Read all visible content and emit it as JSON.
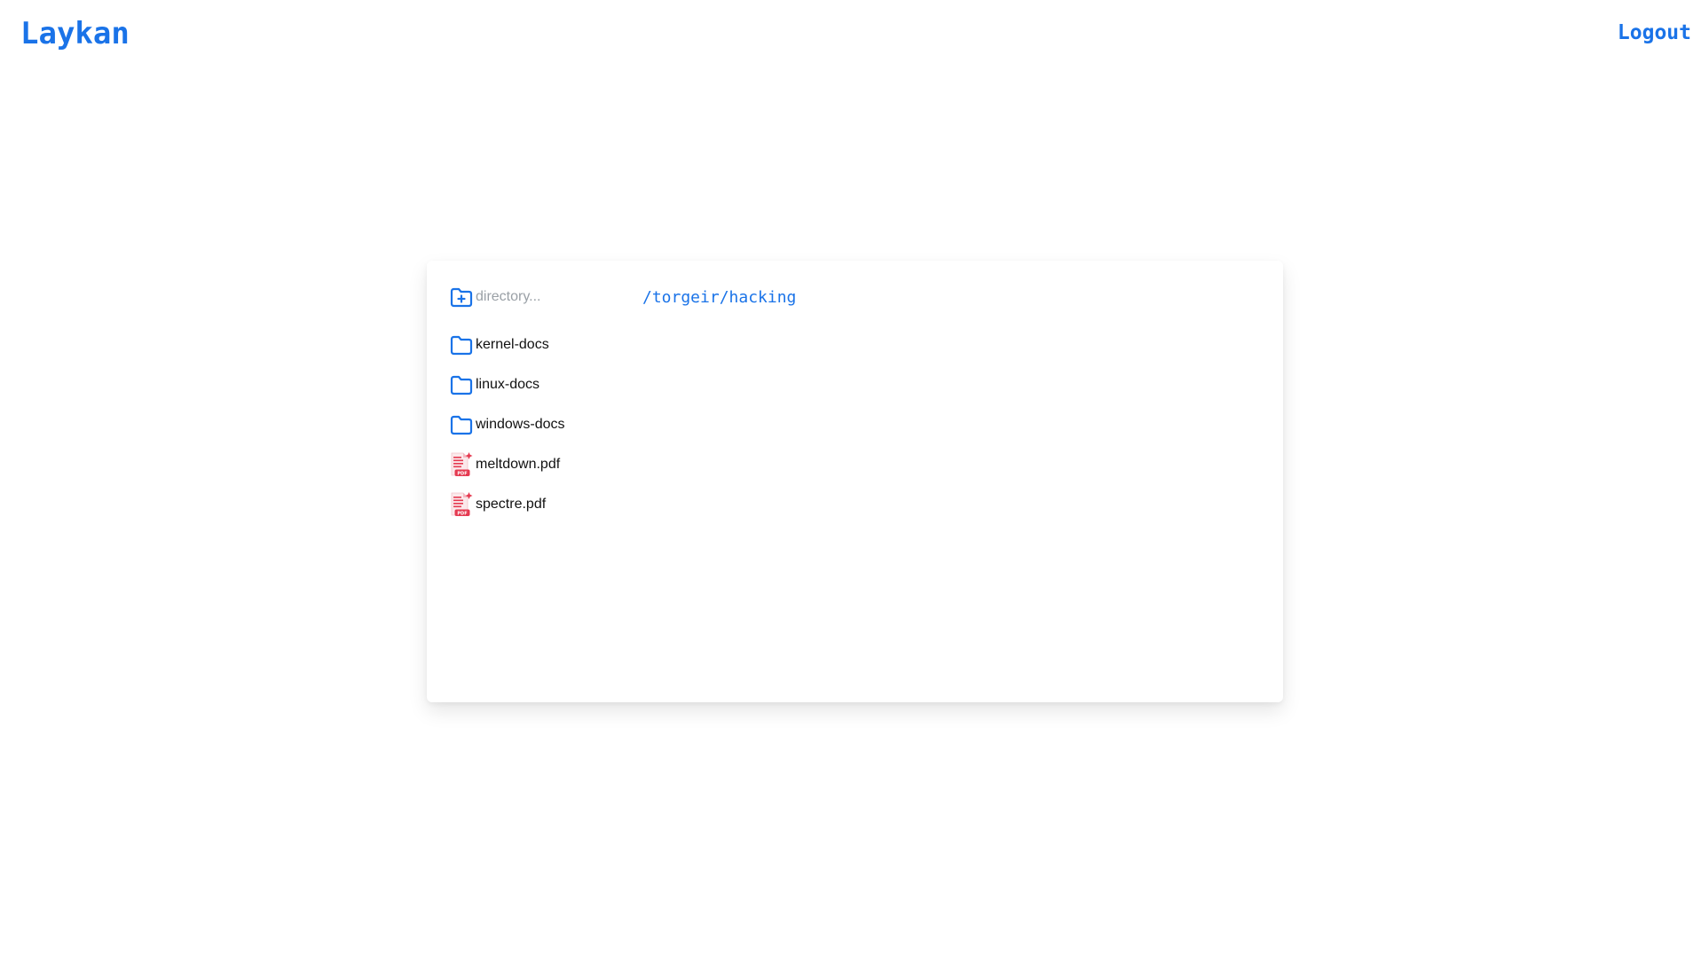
{
  "header": {
    "brand": "Laykan",
    "logout_label": "Logout"
  },
  "toolbar": {
    "new_directory_placeholder": "directory...",
    "new_directory_value": "",
    "current_path": "/torgeir/hacking"
  },
  "entries": [
    {
      "name": "kernel-docs",
      "type": "directory",
      "icon": "folder-icon"
    },
    {
      "name": "linux-docs",
      "type": "directory",
      "icon": "folder-icon"
    },
    {
      "name": "windows-docs",
      "type": "directory",
      "icon": "folder-icon"
    },
    {
      "name": "meltdown.pdf",
      "type": "file",
      "icon": "pdf-file-icon"
    },
    {
      "name": "spectre.pdf",
      "type": "file",
      "icon": "pdf-file-icon"
    }
  ],
  "colors": {
    "accent": "#1a73e8",
    "pdf_red": "#e53950",
    "text": "#111111",
    "placeholder": "#9aa0a6"
  }
}
